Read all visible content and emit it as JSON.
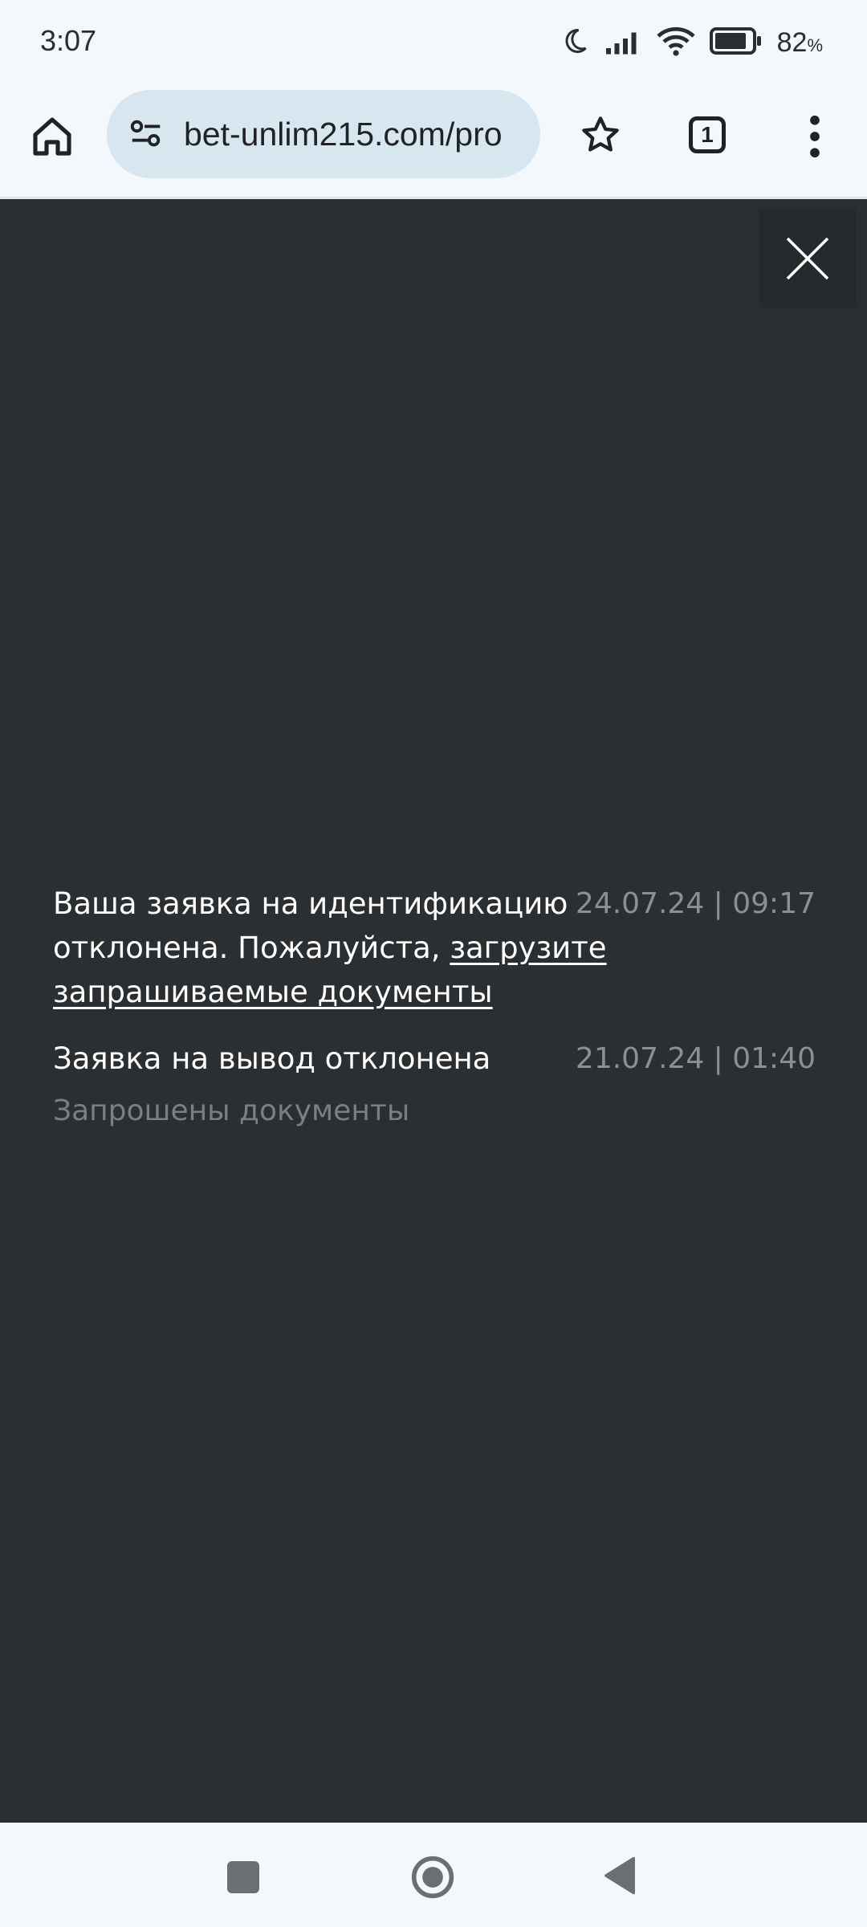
{
  "status_bar": {
    "time": "3:07",
    "battery_percent": "82",
    "battery_unit": "%",
    "icons": [
      "moon-icon",
      "signal-icon",
      "wifi-icon",
      "battery-icon"
    ]
  },
  "browser": {
    "url": "bet-unlim215.com/pro",
    "tab_count": "1",
    "icons": [
      "home-icon",
      "site-settings-icon",
      "star-icon",
      "tabs-icon",
      "more-vert-icon"
    ]
  },
  "notifications": [
    {
      "message_start": "Ваша заявка на идентификацию отклонена. Пожалуйста,",
      "message_link": "загрузите запрашиваемые документы",
      "date": "24.07.24 | 09:17"
    },
    {
      "message_start": "Заявка на вывод отклонена",
      "date": "21.07.24 | 01:40",
      "subtext": "Запрошены документы"
    }
  ],
  "colors": {
    "page_background": "#2c2f31",
    "chrome_background": "#f3f8fc",
    "url_pill": "#d8e6ef"
  }
}
